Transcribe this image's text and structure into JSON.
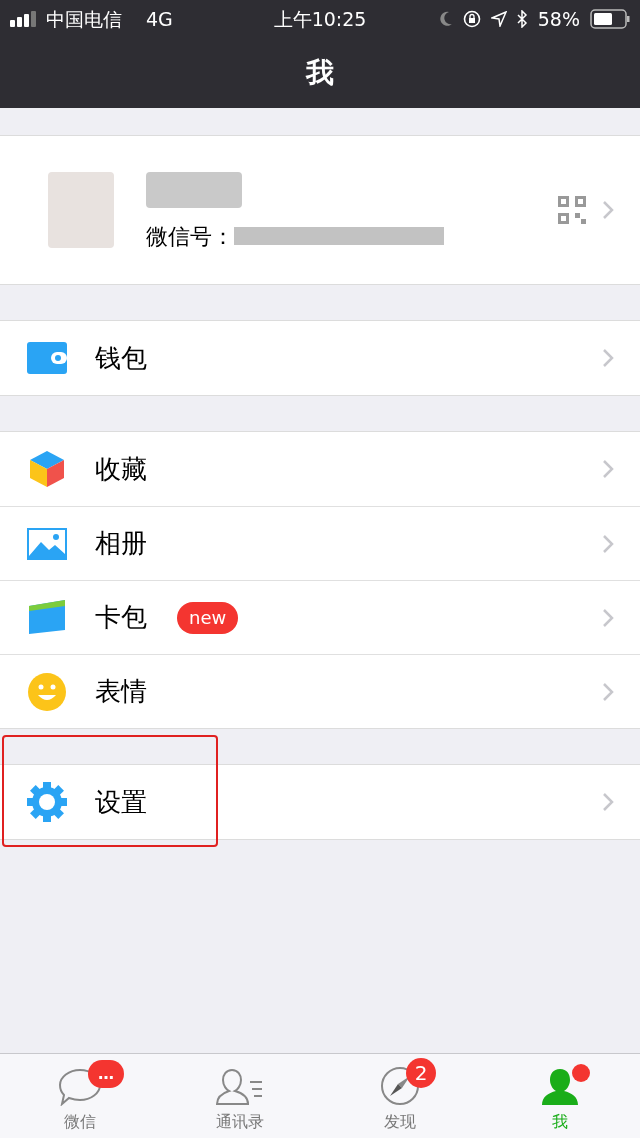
{
  "status_bar": {
    "carrier": "中国电信",
    "network": "4G",
    "time": "上午10:25",
    "battery": "58%"
  },
  "nav": {
    "title": "我"
  },
  "profile": {
    "id_label": "微信号："
  },
  "sections": [
    [
      {
        "kind": "wallet",
        "label": "钱包"
      }
    ],
    [
      {
        "kind": "cube",
        "label": "收藏"
      },
      {
        "kind": "picture",
        "label": "相册"
      },
      {
        "kind": "card",
        "label": "卡包",
        "badge": "new"
      },
      {
        "kind": "smile",
        "label": "表情"
      }
    ],
    [
      {
        "kind": "gear",
        "label": "设置",
        "highlighted": true
      }
    ]
  ],
  "tabs": [
    {
      "kind": "chat",
      "label": "微信",
      "selected": false,
      "badge": {
        "kind": "dots",
        "text": "…"
      }
    },
    {
      "kind": "contacts",
      "label": "通讯录",
      "selected": false
    },
    {
      "kind": "compass",
      "label": "发现",
      "selected": false,
      "badge": {
        "kind": "count",
        "text": "2"
      }
    },
    {
      "kind": "person",
      "label": "我",
      "selected": true,
      "badge": {
        "kind": "dot"
      }
    }
  ]
}
